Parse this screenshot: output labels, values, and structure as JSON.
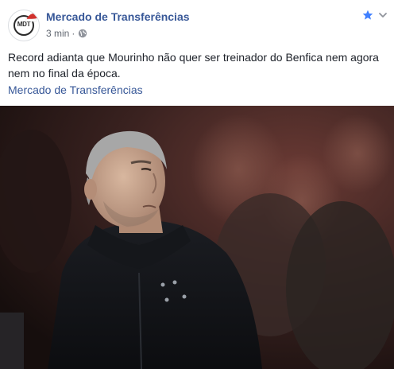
{
  "post": {
    "page_name": "Mercado de Transferências",
    "avatar_text": "MDT",
    "time": "3 min",
    "separator": "·",
    "privacy_icon": "globe-icon",
    "star_icon": "star-icon",
    "menu_icon": "chevron-down-icon",
    "text": "Record adianta que Mourinho não quer ser treinador do Benfica nem agora nem no final da época.",
    "link_text": "Mercado de Transferências",
    "colors": {
      "brand_link": "#385898",
      "meta_text": "#616770",
      "star": "#4080ff"
    }
  }
}
